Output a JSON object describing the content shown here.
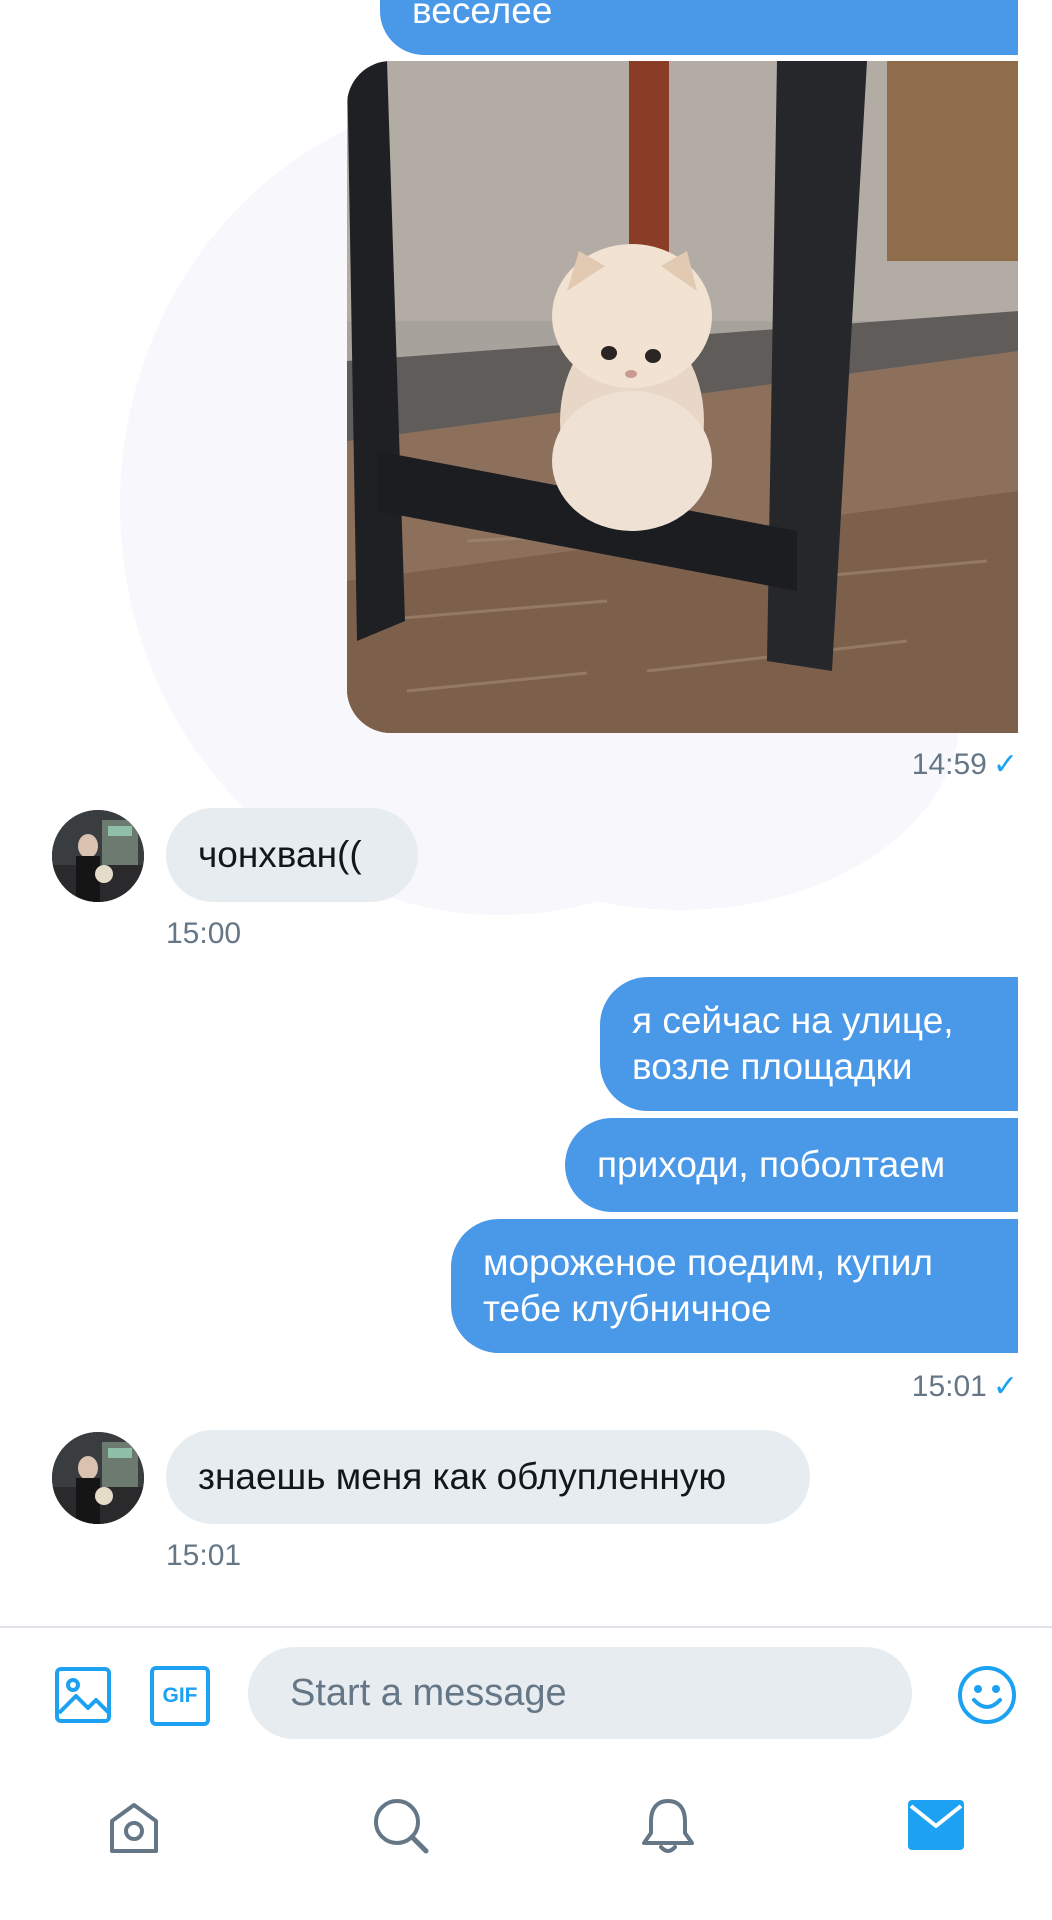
{
  "messages": {
    "out_partial_text": "веселее",
    "photo_time": "14:59",
    "in_1_text": "чонхван((",
    "in_1_time": "15:00",
    "out_1_line1": "я сейчас на улице,",
    "out_1_line2": "возле площадки",
    "out_2_text": "приходи, поболтаем",
    "out_3_line1": "мороженое поедим, купил",
    "out_3_line2": "тебе клубничное",
    "out_group_time": "15:01",
    "in_2_text": "знаешь меня как облупленную",
    "in_2_time": "15:01"
  },
  "composer": {
    "placeholder": "Start a message",
    "gif_label": "GIF"
  },
  "nav": {
    "items": [
      "home-icon",
      "search-icon",
      "notifications-icon",
      "messages-icon"
    ],
    "active": "messages-icon"
  },
  "colors": {
    "accent": "#1da1f2",
    "outgoing_bubble": "#4a99e9",
    "incoming_bubble": "#e6ecf0",
    "muted_text": "#657786"
  }
}
